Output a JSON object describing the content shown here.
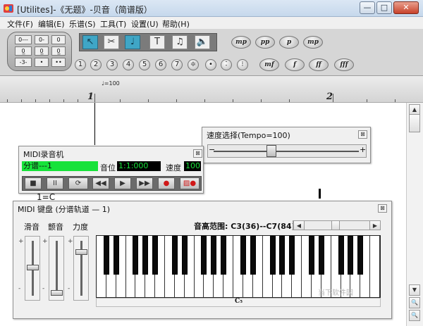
{
  "window": {
    "title": "[Utilites]-《无题》-贝音（简谱版）",
    "min_glyph": "—",
    "max_glyph": "□",
    "close_glyph": "✕"
  },
  "menu": [
    "文件(F)",
    "编辑(E)",
    "乐谱(S)",
    "工具(T)",
    "设置(U)",
    "帮助(H)"
  ],
  "duration_panel": {
    "cells": [
      "0---",
      "0-",
      "0",
      "0̲",
      "0̲̲",
      "0̲̲̲",
      "-3-",
      "•",
      "••"
    ]
  },
  "tools": [
    {
      "name": "select-tool",
      "glyph": "↖"
    },
    {
      "name": "cut-tool",
      "glyph": "✂"
    },
    {
      "name": "note-input-tool",
      "glyph": "♩"
    },
    {
      "name": "text-tool",
      "glyph": "T"
    },
    {
      "name": "lyric-tool",
      "glyph": "♫"
    },
    {
      "name": "speaker-tool",
      "glyph": "🔈"
    }
  ],
  "number_buttons": [
    "1",
    "2",
    "3",
    "4",
    "5",
    "6",
    "7",
    "≑",
    "•",
    "︰",
    "⁝"
  ],
  "dynamics_top": [
    "mp",
    "pp",
    "p",
    "mp"
  ],
  "dynamics_bottom": [
    "mf",
    "f",
    "ff",
    "fff"
  ],
  "ruler": {
    "tempo_mark": "♩=100",
    "measures": [
      "1",
      "2"
    ]
  },
  "tempo_window": {
    "title": "速度选择(Tempo=100)",
    "tempo": 100,
    "min_glyph": "−",
    "max_glyph": "+"
  },
  "recorder": {
    "title": "MIDI录音机",
    "staff": "分谱---1",
    "position_label": "音位",
    "position_value": "1:1:000",
    "speed_label": "速度",
    "speed_value": "100",
    "controls": [
      "■",
      "II",
      "⟳",
      "◀◀",
      "▶",
      "▶▶",
      "●",
      "▨●"
    ]
  },
  "keyboard": {
    "title": "MIDI 键盘 (分谱轨道 — 1)",
    "labels": [
      "滑音",
      "颤音",
      "力度"
    ],
    "range_label": "音高范围:",
    "range_value": "C3(36)--C7(84)",
    "middle_c": "C₅",
    "plus": "+",
    "minus": "-"
  },
  "score_fragment": "1=C",
  "watermark": "当下软件园"
}
